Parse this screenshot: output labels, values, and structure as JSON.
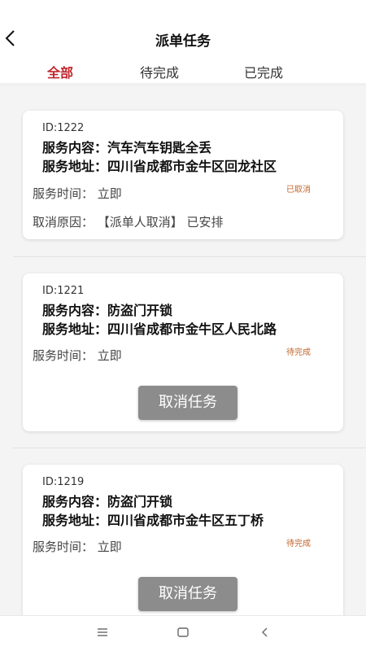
{
  "header": {
    "title": "派单任务"
  },
  "tabs": [
    {
      "label": "全部",
      "active": true
    },
    {
      "label": "待完成",
      "active": false
    },
    {
      "label": "已完成",
      "active": false
    }
  ],
  "colors": {
    "accent": "#c0262c",
    "status": "#c0662c",
    "button": "#8c8c8c"
  },
  "tasks": [
    {
      "id": "ID:1222",
      "content": "服务内容：汽车汽车钥匙全丢",
      "address": "服务地址：四川省成都市金牛区回龙社区",
      "time": "服务时间：  立即",
      "status": "已取消",
      "cancel_reason": "取消原因：  【派单人取消】  已安排"
    },
    {
      "id": "ID:1221",
      "content": "服务内容：防盗门开锁",
      "address": "服务地址：四川省成都市金牛区人民北路",
      "time": "服务时间：  立即",
      "status": "待完成",
      "button": "取消任务"
    },
    {
      "id": "ID:1219",
      "content": "服务内容：防盗门开锁",
      "address": "服务地址：四川省成都市金牛区五丁桥",
      "time": "服务时间：  立即",
      "status": "待完成",
      "button": "取消任务"
    }
  ],
  "navbar": {
    "icons": [
      "menu-icon",
      "home-icon",
      "back-icon"
    ]
  }
}
